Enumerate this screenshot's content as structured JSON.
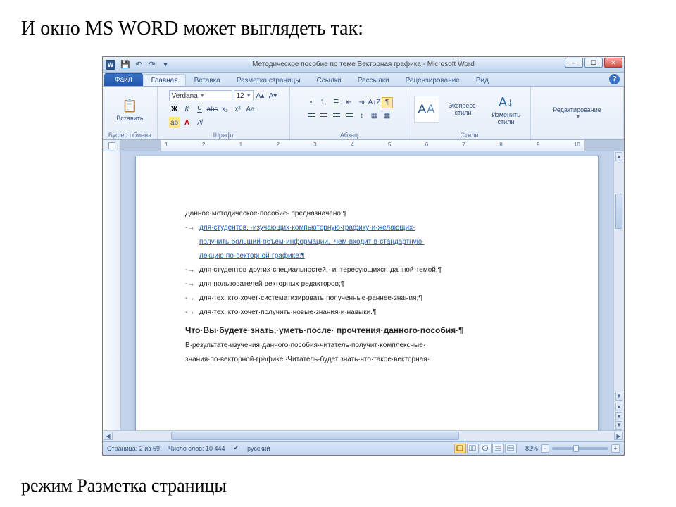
{
  "slide": {
    "heading": "И окно MS WORD может выглядеть так:",
    "caption": "режим Разметка страницы"
  },
  "titlebar": {
    "app_icon_text": "W",
    "document_title": "Методическое пособие по теме Векторная графика - Microsoft Word",
    "qat": {
      "save": "💾",
      "undo": "↶",
      "redo": "↷",
      "customize": "▾"
    },
    "controls": {
      "minimize": "–",
      "maximize": "☐",
      "close": "✕"
    }
  },
  "tabs": {
    "file": "Файл",
    "home": "Главная",
    "insert": "Вставка",
    "layout": "Разметка страницы",
    "references": "Ссылки",
    "mailings": "Рассылки",
    "review": "Рецензирование",
    "view": "Вид",
    "help_symbol": "?"
  },
  "ribbon": {
    "clipboard": {
      "label": "Буфер обмена",
      "paste": "Вставить",
      "paste_icon": "📋"
    },
    "font": {
      "label": "Шрифт",
      "name": "Verdana",
      "size": "12",
      "bold": "Ж",
      "italic": "К",
      "underline": "Ч",
      "strike": "abc",
      "sub": "x₂",
      "sup": "x²",
      "grow": "A▴",
      "shrink": "A▾",
      "case": "Aa",
      "clear": "A̸",
      "highlight": "ab",
      "fontcolor": "A"
    },
    "paragraph": {
      "label": "Абзац",
      "bullets": "•",
      "numbers": "1.",
      "multilevel": "≣",
      "dec_indent": "⇤",
      "inc_indent": "⇥",
      "sort": "A↓Z",
      "marks": "¶",
      "align_left": "L",
      "align_center": "C",
      "align_right": "R",
      "justify": "J",
      "spacing": "↕",
      "shading": "▦",
      "borders": "▦"
    },
    "styles": {
      "label": "Стили",
      "quick_styles": "Экспресс-стили",
      "change_styles": "Изменить\nстили"
    },
    "editing": {
      "label": "",
      "title": "Редактирование"
    }
  },
  "ruler": {
    "numbers": [
      "1",
      "2",
      "1",
      "2",
      "3",
      "4",
      "5",
      "6",
      "7",
      "8",
      "9",
      "10"
    ]
  },
  "document": {
    "p1": "Данное·методическое·пособие· предназначено:¶",
    "b1a": "для·студентов, ·изучающих·компьютерную·графику·и·желающих·",
    "b1b": "получить·больший·объем·информации, ·чем·входит·в·стандартную·",
    "b1c": "лекцию·по·векторной·графике;¶",
    "b2": "для·студентов·других·специальностей,· интересующихся·данной·темой;¶",
    "b3": "для·пользователей·векторных·редакторов;¶",
    "b4": "для·тех, кто·хочет·систематизировать·полученные·раннее·знания;¶",
    "b5": "для·тех, кто·хочет·получить·новые·знания·и·навыки.¶",
    "h1": "Что·Вы·будете·знать,·уметь·после· прочтения·данного·пособия·¶",
    "p2a": "В·результате·изучения·данного·пособия·читатель·получит·комплексные·",
    "p2b": "знания·по·векторной·графике.·Читатель·будет знать·что·такое·векторная·"
  },
  "status": {
    "page": "Страница: 2 из 59",
    "words": "Число слов: 10 444",
    "lang_icon": "✔",
    "lang": "русский",
    "zoom_pct": "82%",
    "zoom_minus": "−",
    "zoom_plus": "+"
  }
}
